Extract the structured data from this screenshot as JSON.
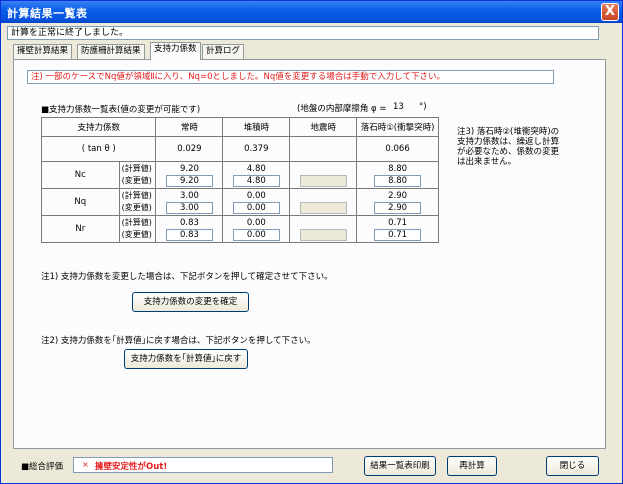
{
  "window": {
    "title": "計算結果一覧表",
    "close_glyph": "X"
  },
  "status": "計算を正常に終了しました。",
  "tabs": [
    "擁壁計算結果",
    "防護柵計算結果",
    "支持力係数",
    "計算ログ"
  ],
  "active_tab": 2,
  "warning": "注) 一部のケースでNq値が領域Ⅱに入り、Nq=0としました。Nq値を変更する場合は手動で入力して下さい。",
  "table": {
    "title": "■支持力係数一覧表(値の変更が可能です)",
    "friction_label": "(地盤の内部摩擦角 φ =",
    "friction_value": "13",
    "friction_unit": "°)",
    "headers": [
      "支持力係数",
      "常時",
      "堆積時",
      "地震時",
      "落石時①(衝撃突時)"
    ],
    "tan_row": {
      "label": "( tan θ )",
      "values": [
        "0.029",
        "0.379",
        "",
        "0.066"
      ]
    },
    "sub_calc": "(計算値)",
    "sub_changed": "(変更値)",
    "rows": [
      {
        "symbol": "Nc",
        "calc": [
          "9.20",
          "4.80",
          "",
          "8.80"
        ],
        "changed": [
          "9.20",
          "4.80",
          "",
          "8.80"
        ]
      },
      {
        "symbol": "Nq",
        "calc": [
          "3.00",
          "0.00",
          "",
          "2.90"
        ],
        "changed": [
          "3.00",
          "0.00",
          "",
          "2.90"
        ]
      },
      {
        "symbol": "Nr",
        "calc": [
          "0.83",
          "0.00",
          "",
          "0.71"
        ],
        "changed": [
          "0.83",
          "0.00",
          "",
          "0.71"
        ]
      }
    ]
  },
  "note3": "注3) 落石時②(堆衝突時)の支持力係数は、繰返し計算が必要なため、係数の変更は出来ません。",
  "note1": "注1) 支持力係数を変更した場合は、下記ボタンを押して確定させて下さい。",
  "confirm_button": "支持力係数の変更を確定",
  "note2": "注2) 支持力係数を｢計算値｣に戻す場合は、下記ボタンを押して下さい。",
  "reset_button": "支持力係数を｢計算値｣に戻す",
  "evaluation": {
    "label": "■総合評価",
    "mark": "×",
    "text": "擁壁安定性がOut!"
  },
  "buttons": {
    "print": "結果一覧表印刷",
    "recalc": "再計算",
    "close": "閉じる"
  },
  "colors": {
    "title_bar": "#0553e0",
    "warning_text": "#e31b1b",
    "window_bg": "#ece9d8"
  }
}
